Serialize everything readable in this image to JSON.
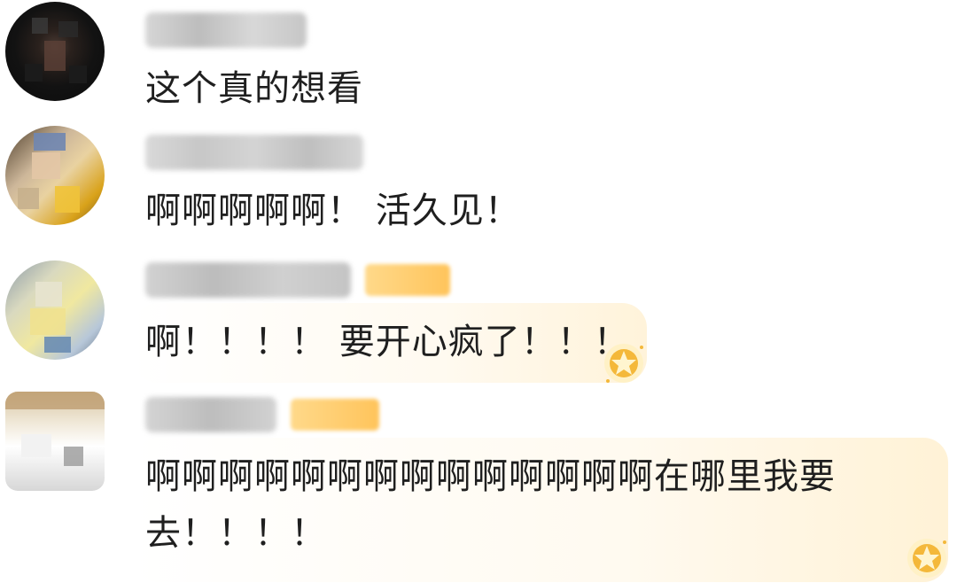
{
  "comments": [
    {
      "text": "这个真的想看",
      "avatar_icon": "blurred-avatar-dark",
      "username_blurred": true,
      "has_vip_badge": false,
      "has_highlight_bubble": false
    },
    {
      "text": "啊啊啊啊啊！ 活久见！",
      "avatar_icon": "blurred-avatar-painting",
      "username_blurred": true,
      "has_vip_badge": false,
      "has_highlight_bubble": false
    },
    {
      "text": "啊！！！！ 要开心疯了！！！",
      "avatar_icon": "blurred-avatar-cartoon",
      "username_blurred": true,
      "has_vip_badge": true,
      "has_highlight_bubble": true
    },
    {
      "text": "啊啊啊啊啊啊啊啊啊啊啊啊啊啊在哪里我要去！！！！",
      "avatar_icon": "blurred-avatar-light",
      "username_blurred": true,
      "has_vip_badge": true,
      "has_highlight_bubble": true
    }
  ],
  "colors": {
    "text": "#1f1f1f",
    "bubble": "#fff8ea",
    "vip_badge": "#ffc45b",
    "star": "#f4b83a",
    "username_blur": "#c9c9c9"
  }
}
